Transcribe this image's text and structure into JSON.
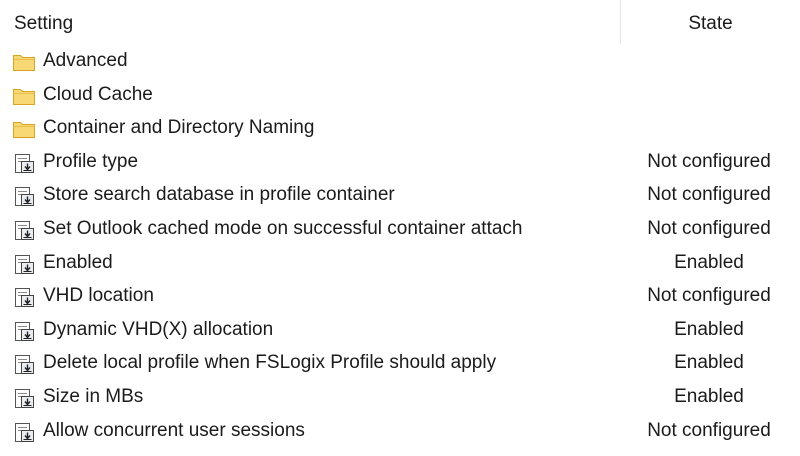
{
  "columns": {
    "setting": "Setting",
    "state": "State"
  },
  "folders": [
    {
      "label": "Advanced",
      "icon": "folder-icon"
    },
    {
      "label": "Cloud Cache",
      "icon": "folder-icon"
    },
    {
      "label": "Container and Directory Naming",
      "icon": "folder-icon"
    }
  ],
  "policies": [
    {
      "label": "Profile type",
      "state": "Not configured",
      "icon": "policy-setting-icon"
    },
    {
      "label": "Store search database in profile container",
      "state": "Not configured",
      "icon": "policy-setting-icon"
    },
    {
      "label": "Set Outlook cached mode on successful container attach",
      "state": "Not configured",
      "icon": "policy-setting-icon"
    },
    {
      "label": "Enabled",
      "state": "Enabled",
      "icon": "policy-setting-icon"
    },
    {
      "label": "VHD location",
      "state": "Not configured",
      "icon": "policy-setting-icon"
    },
    {
      "label": "Dynamic VHD(X) allocation",
      "state": "Enabled",
      "icon": "policy-setting-icon"
    },
    {
      "label": "Delete local profile when FSLogix Profile should apply",
      "state": "Enabled",
      "icon": "policy-setting-icon"
    },
    {
      "label": "Size in MBs",
      "state": "Enabled",
      "icon": "policy-setting-icon"
    },
    {
      "label": "Allow concurrent user sessions",
      "state": "Not configured",
      "icon": "policy-setting-icon"
    }
  ],
  "colors": {
    "folder_fill": "#f8d775",
    "folder_stroke": "#d9a520",
    "icon_stroke": "#4a4a4a",
    "divider": "#e5e5e5"
  }
}
